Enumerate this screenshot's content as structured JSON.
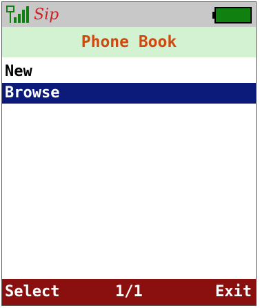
{
  "status_bar": {
    "signal_icon": "signal-strength-icon",
    "sip_icon": "sip-icon",
    "sip_text": "Sip",
    "battery_icon": "battery-full-icon",
    "colors": {
      "signal": "#108010",
      "sip": "#d02020",
      "battery": "#108010"
    }
  },
  "title": "Phone Book",
  "list": {
    "items": [
      {
        "label": "New",
        "selected": false
      },
      {
        "label": "Browse",
        "selected": true
      }
    ]
  },
  "softkeys": {
    "left": "Select",
    "page": "1/1",
    "right": "Exit"
  },
  "colors": {
    "title_bg": "#d2f2d2",
    "title_text": "#d04a10",
    "selection_bg": "#0c1a7a",
    "softkey_bg": "#8a1010"
  }
}
